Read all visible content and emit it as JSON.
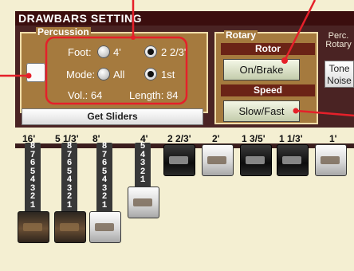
{
  "window": {
    "title": "DRAWBARS SETTING"
  },
  "percussion": {
    "legend": "Percussion",
    "checkbox_checked": false,
    "foot_label": "Foot:",
    "foot_options": [
      "4'",
      "2 2/3'"
    ],
    "foot_selected": "2 2/3'",
    "mode_label": "Mode:",
    "mode_options": [
      "All",
      "1st"
    ],
    "mode_selected": "1st",
    "vol_text": "Vol.: 64",
    "length_text": "Length: 84",
    "get_sliders_label": "Get Sliders"
  },
  "rotary": {
    "legend": "Rotary",
    "rotor_title": "Rotor",
    "rotor_button": "On/Brake",
    "speed_title": "Speed",
    "speed_button": "Slow/Fast"
  },
  "perc_rotary": {
    "label_line1": "Perc.",
    "label_line2": "Rotary",
    "tone_line1": "Tone",
    "tone_line2": "Noise"
  },
  "drawbars": [
    {
      "footage": "16'",
      "level": 8,
      "knob": "brown"
    },
    {
      "footage": "5 1/3'",
      "level": 8,
      "knob": "brown"
    },
    {
      "footage": "8'",
      "level": 8,
      "knob": "white"
    },
    {
      "footage": "4'",
      "level": 5,
      "knob": "white"
    },
    {
      "footage": "2 2/3'",
      "level": 0,
      "knob": "black"
    },
    {
      "footage": "2'",
      "level": 0,
      "knob": "white"
    },
    {
      "footage": "1 3/5'",
      "level": 0,
      "knob": "black"
    },
    {
      "footage": "1 1/3'",
      "level": 0,
      "knob": "black"
    },
    {
      "footage": "1'",
      "level": 0,
      "knob": "white"
    }
  ],
  "accent_colors": {
    "annotation": "#e5202a",
    "title_bar": "#3b0e0e",
    "panel": "#a57a3e"
  }
}
